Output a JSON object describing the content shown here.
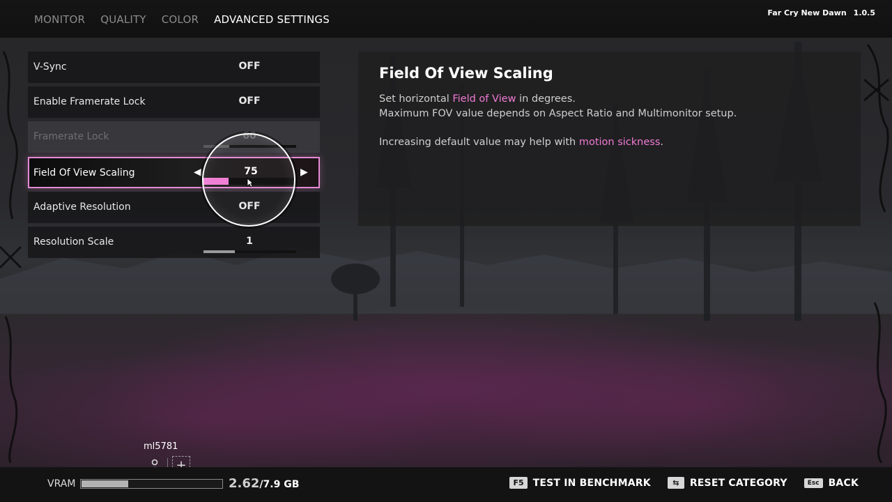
{
  "header": {
    "tabs": [
      {
        "label": "MONITOR",
        "active": false
      },
      {
        "label": "QUALITY",
        "active": false
      },
      {
        "label": "COLOR",
        "active": false
      },
      {
        "label": "ADVANCED SETTINGS",
        "active": true
      }
    ],
    "game_name": "Far Cry New Dawn",
    "version": "1.0.5"
  },
  "settings": [
    {
      "label": "V-Sync",
      "value": "OFF"
    },
    {
      "label": "Enable Framerate Lock",
      "value": "OFF"
    },
    {
      "label": "Framerate Lock",
      "value": "60",
      "disabled": true,
      "slider_fraction": 0.28
    },
    {
      "label": "Field Of View Scaling",
      "value": "75",
      "selected": true,
      "slider_fraction": 0.27
    },
    {
      "label": "Adaptive Resolution",
      "value": "OFF"
    },
    {
      "label": "Resolution Scale",
      "value": "1",
      "slider_fraction": 0.34
    }
  ],
  "info": {
    "title": "Field Of View Scaling",
    "line1_pre": "Set horizontal ",
    "line1_highlight": "Field of View",
    "line1_post": " in degrees.",
    "line2": "Maximum FOV value depends on Aspect Ratio and Multimonitor setup.",
    "line3_pre": "Increasing default value may help with ",
    "line3_highlight": "motion sickness",
    "line3_post": "."
  },
  "user": {
    "name": "ml5781"
  },
  "vram": {
    "label": "VRAM",
    "used": "2.62",
    "total": "/7.9 GB",
    "fraction": 0.33
  },
  "hints": [
    {
      "key": "F5",
      "label": "TEST IN BENCHMARK"
    },
    {
      "key": "⇆",
      "label": "RESET CATEGORY"
    },
    {
      "key": "Esc",
      "label": "BACK"
    }
  ],
  "colors": {
    "accent": "#f07ad3",
    "panel": "#161618"
  },
  "icons": [
    "user-icon",
    "add-icon",
    "arrow-left-icon",
    "arrow-right-icon",
    "cursor-icon"
  ]
}
